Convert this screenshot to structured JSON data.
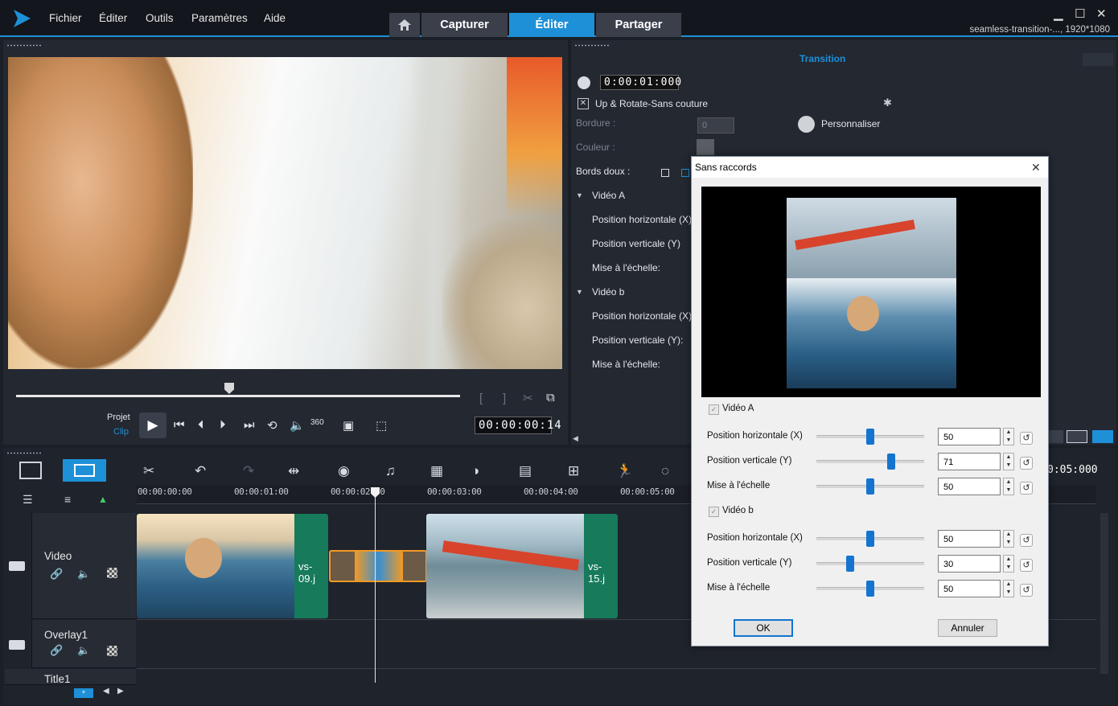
{
  "menu": {
    "fichier": "Fichier",
    "editer": "Éditer",
    "outils": "Outils",
    "parametres": "Paramètres",
    "aide": "Aide"
  },
  "tabs": {
    "capturer": "Capturer",
    "editer": "Éditer",
    "partager": "Partager"
  },
  "project": {
    "name": "seamless-transition-..., 1920*1080"
  },
  "player": {
    "projet": "Projet",
    "clip": "Clip",
    "timecode": "00:00:00:14",
    "bracket_in": "[",
    "bracket_out": "]",
    "play_glyph": "▶"
  },
  "options": {
    "title": "Transition",
    "duration": "0:00:01:000",
    "effect_name": "Up & Rotate-Sans couture",
    "bordure_label": "Bordure :",
    "bordure_value": "0",
    "couleur_label": "Couleur :",
    "bords_doux_label": "Bords doux :",
    "personnaliser": "Personnaliser",
    "video_a": "Vidéo A",
    "video_b": "Vidéo b",
    "pos_h": "Position horizontale (X)",
    "pos_v": "Position verticale (Y)",
    "pos_v2": "Position verticale (Y):",
    "scale": "Mise à l'échelle:"
  },
  "timeline": {
    "ruler": [
      "00:00:00:00",
      "00:00:01:00",
      "00:00:02:00",
      "00:00:03:00",
      "00:00:04:00",
      "00:00:05:00"
    ],
    "duration": "0:05:000",
    "tracks": {
      "video": "Video",
      "overlay": "Overlay1",
      "title": "Title1"
    },
    "clip1_end": "vs-09.j",
    "clip2_end": "vs-15.j"
  },
  "dialog": {
    "title": "Sans raccords",
    "close": "✕",
    "video_a": "Vidéo A",
    "video_b": "Vidéo b",
    "pos_h": "Position horizontale (X)",
    "pos_v": "Position verticale (Y)",
    "scale": "Mise à l'échelle",
    "a_h": "50",
    "a_v": "71",
    "a_s": "50",
    "b_h": "50",
    "b_v": "30",
    "b_s": "50",
    "a_h_level": 50,
    "a_v_level": 71,
    "a_s_level": 50,
    "b_h_level": 50,
    "b_v_level": 30,
    "b_s_level": 50,
    "ok": "OK",
    "cancel": "Annuler"
  },
  "colors": {
    "accent": "#1e90d8",
    "clip_end": "#167a5b",
    "transition": "#f39a24",
    "slider_thumb": "#1474cf"
  },
  "icons": [
    "home-icon",
    "clock-icon",
    "gear-icon",
    "play-icon",
    "scissors-icon",
    "undo-icon",
    "redo-icon",
    "close-icon"
  ]
}
